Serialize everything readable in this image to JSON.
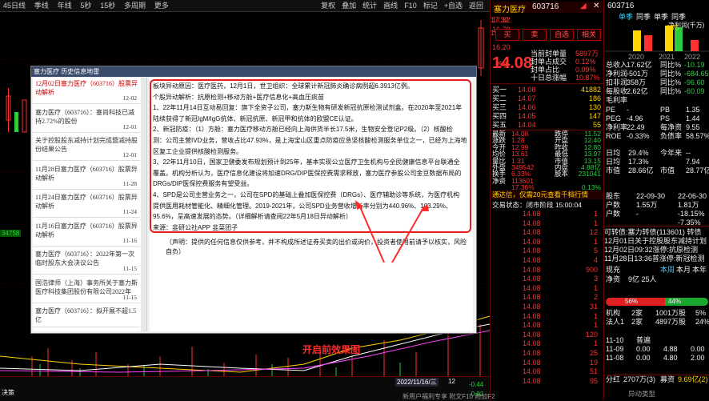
{
  "topbar": {
    "items": [
      "45日线",
      "季线",
      "年线",
      "5秒",
      "15秒",
      "多周期",
      "更多"
    ],
    "right_items": [
      "复权",
      "叠加",
      "统计",
      "画线",
      "F10",
      "标记",
      "+自选",
      "返回"
    ]
  },
  "chart": {
    "price_label": "34758",
    "bottom_labels": [
      "决策",
      "2022/11/16/三",
      "12",
      "-0.44",
      "-0.92",
      "15"
    ]
  },
  "midpanel": {
    "header": {
      "name": "塞力医疗",
      "code": "603716"
    },
    "price_scale": [
      "17.32",
      "16.78",
      "16.20",
      "15.05",
      "14.44",
      "13.88",
      "13.20",
      "12.76",
      "12.72"
    ],
    "buttons": [
      "买",
      "卖",
      "自选",
      "相关"
    ],
    "quote": {
      "price": "14.08",
      "change": "-",
      "stat": [
        {
          "l": "当前封单量",
          "v": "5897万"
        },
        {
          "l": "封单占成交",
          "v": "0.12%"
        },
        {
          "l": "封单占比",
          "v": "0.09%"
        },
        {
          "l": "十日总涨幅",
          "v": "10.87%"
        }
      ]
    },
    "tag": "首板",
    "orderbook": [
      {
        "l": "买一",
        "p": "14.08",
        "v": "41882"
      },
      {
        "l": "买二",
        "p": "14.07",
        "v": "186"
      },
      {
        "l": "买三",
        "p": "14.06",
        "v": "130"
      },
      {
        "l": "买四",
        "p": "14.05",
        "v": "147"
      },
      {
        "l": "买五",
        "p": "14.04",
        "v": "55"
      }
    ],
    "stats": [
      {
        "l": "最新",
        "v": "14.08",
        "l2": "跌停",
        "v2": "11.52"
      },
      {
        "l": "涨跌",
        "v": "1.28",
        "l2": "开盘",
        "v2": "12.40"
      },
      {
        "l": "今开",
        "v": "12.99",
        "l2": "昨收",
        "v2": "12.80"
      },
      {
        "l": "均价",
        "v": "13.61",
        "l2": "最低",
        "v2": "13.97"
      },
      {
        "l": "量比",
        "v": "1.31",
        "l2": "市值",
        "v2": "13.15"
      },
      {
        "l": "外盘",
        "v": "349542",
        "l2": "内盘",
        "v2": "4.88亿"
      },
      {
        "l": "换手",
        "v": "6.33%",
        "l2": "股本",
        "v2": "231041"
      },
      {
        "l": "净资",
        "v": "113601",
        "l2": "",
        "v2": ""
      },
      {
        "l": "",
        "v": "17.36%",
        "l2": "",
        "v2": "0.13%"
      }
    ],
    "notice": "通达信，仅需20元查看千档行情",
    "status": "交易状态：闭市阶段 15:00:04",
    "ticks": [
      {
        "t": "",
        "p": "14.08",
        "v": "1"
      },
      {
        "t": "",
        "p": "14.08",
        "v": "1"
      },
      {
        "t": "",
        "p": "14.08",
        "v": "12"
      },
      {
        "t": "",
        "p": "14.08",
        "v": "1"
      },
      {
        "t": "",
        "p": "14.08",
        "v": "5"
      },
      {
        "t": "",
        "p": "14.08",
        "v": "4"
      },
      {
        "t": "",
        "p": "14.08",
        "v": "900"
      },
      {
        "t": "",
        "p": "14.08",
        "v": "3"
      },
      {
        "t": "",
        "p": "14.08",
        "v": "1"
      },
      {
        "t": "",
        "p": "14.08",
        "v": "2"
      },
      {
        "t": "",
        "p": "14.08",
        "v": "31"
      },
      {
        "t": "",
        "p": "14.08",
        "v": "1"
      },
      {
        "t": "",
        "p": "14.08",
        "v": "1"
      },
      {
        "t": "",
        "p": "14.08",
        "v": "120"
      },
      {
        "t": "",
        "p": "14.08",
        "v": "1"
      },
      {
        "t": "",
        "p": "14.08",
        "v": "25"
      },
      {
        "t": "",
        "p": "14.08",
        "v": "19"
      },
      {
        "t": "",
        "p": "14.08",
        "v": "51"
      },
      {
        "t": "",
        "p": "14.08",
        "v": "95"
      }
    ],
    "footer": "新用户福利专享 附文F10 附加F2"
  },
  "rightpanel": {
    "code": "603716",
    "tabs": [
      "单季",
      "同季",
      "单季",
      "同季"
    ],
    "chart_title": "净利润(千万)",
    "bar_values": [
      "1.75",
      "-6.85"
    ],
    "years": [
      "2020",
      "2021",
      "2022"
    ],
    "fin": [
      {
        "l": "总收入",
        "v": "17.62亿",
        "l2": "同比%",
        "v2": "-10.19"
      },
      {
        "l": "净利润",
        "v": "-501万",
        "l2": "同比%",
        "v2": "-684.65"
      },
      {
        "l": "扣非润",
        "v": "358万",
        "l2": "同比%",
        "v2": "-96.60"
      },
      {
        "l": "每股收",
        "v": "2.62亿",
        "l2": "同比%",
        "v2": "-60.09"
      },
      {
        "l": "毛利率",
        "v": "",
        "l2": "",
        "v2": ""
      }
    ],
    "val": [
      {
        "l": "PE",
        "v": "-",
        "l2": "PB",
        "v2": "1.35"
      },
      {
        "l": "PEG",
        "v": "-4.96",
        "l2": "PS",
        "v2": "1.44"
      },
      {
        "l": "净利率",
        "v": "22.49",
        "l2": "每净资",
        "v2": "9.55"
      },
      {
        "l": "ROE",
        "v": "-0.33%",
        "l2": "负债率",
        "v2": "58.57%"
      }
    ],
    "share": [
      {
        "l": "日均",
        "v": "29.4%",
        "l2": "今年来",
        "v2": "--"
      },
      {
        "l": "日均",
        "v": "17.3%",
        "l2": "",
        "v2": "7.94"
      },
      {
        "l": "市值",
        "v": "28.66亿",
        "l2": "市值",
        "v2": "28.77亿"
      }
    ],
    "holders": [
      {
        "l": "股东",
        "v": "22-09-30",
        "v2": "22-06-30"
      },
      {
        "l": "户数",
        "v": "1.55万",
        "v2": "1.81万"
      },
      {
        "l": "户数",
        "v": "-",
        "v2": "-18.15%"
      },
      {
        "l": "",
        "v": "",
        "v2": "-7.35%"
      }
    ],
    "news": [
      "可转债:塞力转债(113601) 转债",
      "12月01日关于控股股东减持计划",
      "12月02日09:32涨停:抗原检测",
      "11月28日13:36普涨停:新冠检测"
    ],
    "flow_tabs": [
      "现充",
      "本周",
      "本月",
      "本年"
    ],
    "flow_head": {
      "l": "净资",
      "v": "9亿 25人"
    },
    "ratio": {
      "left": "56%",
      "right": "44%"
    },
    "inst": [
      {
        "l": "机构",
        "v": "2家",
        "v2": "1001万股",
        "v3": "5%"
      },
      {
        "l": "法人1",
        "v": "2家",
        "v2": "4897万股",
        "v3": "24%"
      },
      {
        "l": "",
        "v": "",
        "v2": "",
        "v3": ""
      }
    ],
    "dates": [
      {
        "d": "11-10",
        "v": "普遍",
        "v2": "",
        "v3": ""
      },
      {
        "l": "11-09",
        "v": "0.00",
        "v2": "4.88",
        "v3": "0.00"
      },
      {
        "d": "11-08",
        "v": "0.00",
        "v2": "4.80",
        "v3": "2.00"
      },
      {
        "d": "",
        "v": "",
        "v2": "",
        "v3": ""
      }
    ],
    "bottom": {
      "l": "分红",
      "v": "2707万(3)",
      "l2": "募资",
      "v2": "9.69亿(2)"
    },
    "footer": "异动类型"
  },
  "dialog": {
    "title": "塞力医疗 历史信息地雷",
    "list": [
      {
        "title": "12月02日塞力医疗（603716）股票异动解析",
        "date": "12-02",
        "selected": true
      },
      {
        "title": "塞力医疗（603716）：塞尚科技已减持2.72%的股份",
        "date": "12-01",
        "selected": false
      },
      {
        "title": "关于控股股东减持计划完成暨减持股份结果公告",
        "date": "12-01",
        "selected": false
      },
      {
        "title": "11月28日塞力医疗（603716）股票异动解析",
        "date": "11-28",
        "selected": false
      },
      {
        "title": "11月24日塞力医疗（603716）股票异动解析",
        "date": "11-24",
        "selected": false
      },
      {
        "title": "11月16日塞力医疗（603716）股票异动解析",
        "date": "11-16",
        "selected": false
      },
      {
        "title": "塞力医疗（603716）：2022年第一次临时股东大会决议公告",
        "date": "11-15",
        "selected": false
      },
      {
        "title": "国浩律师（上海）事务所关于塞力斯医疗科技集团股份有限公司2022年",
        "date": "11-15",
        "selected": false
      },
      {
        "title": "塞力医疗（603716）：拟开展不超1.5亿",
        "date": "",
        "selected": false
      }
    ],
    "body": [
      "板块异动原因：医疗医药，12月1日，世卫组织：全球累计新冠肺炎确诊病例超6.3913亿例。",
      "个股异动解析：抗原检测+移动方舱+医疗信息化+高血压痰苗",
      "1、22年11月14日互动易回复：旗下全资子公司，塞力斯生物有研发新冠抗原检测试剂盒。在2020年至2021年",
      "陆续获得了新冠IgM/IgG抗体、新冠抗原、新冠甲和抗体的欧盟CE认证。",
      "2、新冠防疫：（1）方舱：塞力医疗移动方舱已经向上海供货半长17.5米，生物安全登记P2级。（2）核酸检",
      "测：公司主营IVD业务，营收占比47.93%，是上海宝山区重点防疫应急坚核酸检测服务单位之一，已经为上海地",
      "区复工企业提供核酸检测服务。",
      "3、22年11月10日，国家卫健委发布规划预计到25年，基本实现公立医疗卫生机构与全民健康信息平台联通全",
      "覆盖。机构分析认为，医疗信息化建设将加速DRG/DIP医保控费需求释放，塞力医疗参股公司金豆数据布局的",
      "DRGs/DIP医保控费服务有望受益。",
      "4、SPD是公司主营业务之一，公司在SPD的基础上叠加医保控费（DRGs）、医疗辅助诊等系统，为医疗机构",
      "提供医用耗材管能化、精细化管理。2019-2021年，公司SPD业务营收增长率分别为440.96%、103.29%、",
      "95.6%，呈高速发展的态势。（详细解析请查阅22年5月18日异动解析）",
      "来源：韭研公社APP  韭菜团子"
    ],
    "disclaimer": "（声明：提供的任何信息仅供参考，并不构成所述证券买卖的出价或询价，投资者使用前请予以核实，风险自负）"
  },
  "annotation": "开启前效果图"
}
